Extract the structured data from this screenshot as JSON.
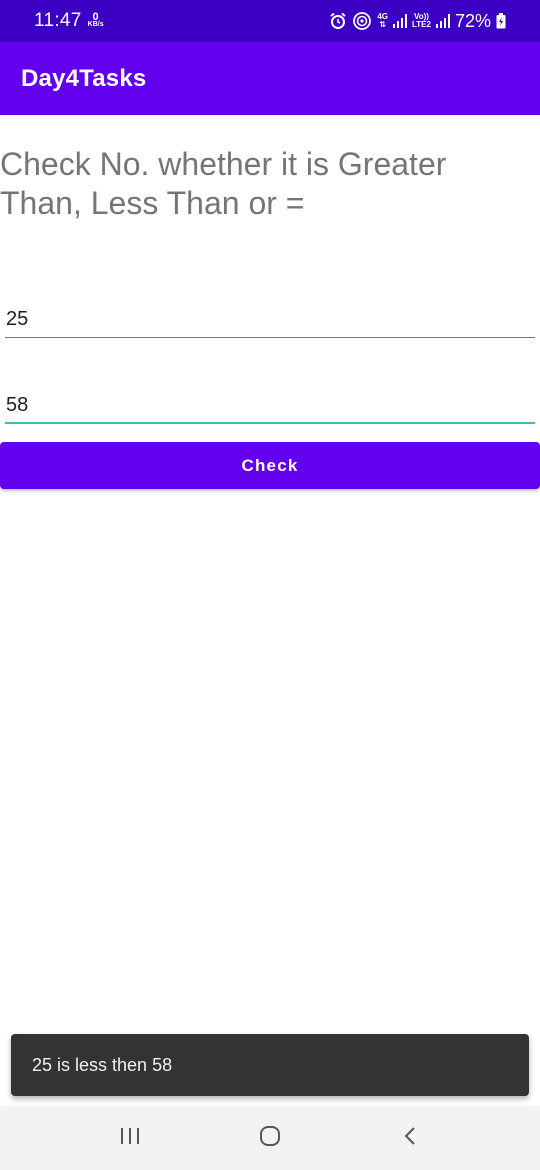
{
  "status_bar": {
    "time": "11:47",
    "speed_value": "0",
    "speed_unit": "KB/s",
    "network_type": "4G",
    "volte_top": "Vo))",
    "volte_bottom": "LTE2",
    "battery": "72%",
    "icons": [
      "alarm-icon",
      "hotspot-icon",
      "signal-icon",
      "battery-icon"
    ]
  },
  "app_bar": {
    "title": "Day4Tasks"
  },
  "heading": "Check No. whether it is Greater Than, Less Than or =",
  "inputs": {
    "first": {
      "value": "25"
    },
    "second": {
      "value": "58"
    }
  },
  "check_button": {
    "label": "Check"
  },
  "toast": {
    "message": "25 is less then 58"
  },
  "nav_bar": {
    "icons": [
      "recent-apps-icon",
      "home-icon",
      "back-icon"
    ]
  },
  "colors": {
    "status_bar": "#3b00c4",
    "primary": "#6200ee",
    "accent": "#2ec4b6",
    "toast": "#333333"
  }
}
